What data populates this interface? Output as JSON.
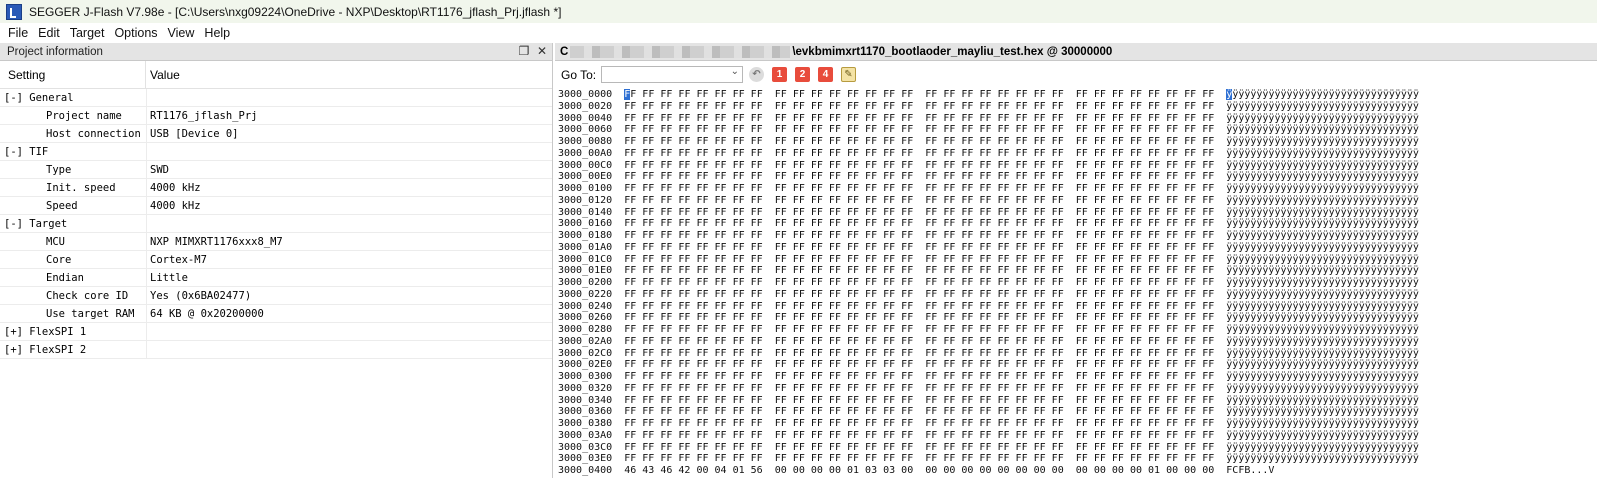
{
  "window": {
    "title": "SEGGER J-Flash V7.98e - [C:\\Users\\nxg09224\\OneDrive - NXP\\Desktop\\RT1176_jflash_Prj.jflash *]"
  },
  "menu": [
    "File",
    "Edit",
    "Target",
    "Options",
    "View",
    "Help"
  ],
  "project_panel": {
    "title": "Project information",
    "col_setting": "Setting",
    "col_value": "Value",
    "rows": [
      {
        "kind": "group",
        "key": "[-] General",
        "value": ""
      },
      {
        "kind": "sub",
        "key": "Project name",
        "value": "RT1176_jflash_Prj"
      },
      {
        "kind": "sub",
        "key": "Host connection",
        "value": "USB [Device 0]"
      },
      {
        "kind": "group",
        "key": "[-] TIF",
        "value": ""
      },
      {
        "kind": "sub",
        "key": "Type",
        "value": "SWD"
      },
      {
        "kind": "sub",
        "key": "Init. speed",
        "value": "4000 kHz"
      },
      {
        "kind": "sub",
        "key": "Speed",
        "value": "4000 kHz"
      },
      {
        "kind": "group",
        "key": "[-] Target",
        "value": ""
      },
      {
        "kind": "sub",
        "key": "MCU",
        "value": "NXP MIMXRT1176xxx8_M7"
      },
      {
        "kind": "sub",
        "key": "Core",
        "value": "Cortex-M7"
      },
      {
        "kind": "sub",
        "key": "Endian",
        "value": "Little"
      },
      {
        "kind": "sub",
        "key": "Check core ID",
        "value": "Yes (0x6BA02477)"
      },
      {
        "kind": "sub",
        "key": "Use target RAM",
        "value": "64 KB @ 0x20200000"
      },
      {
        "kind": "group",
        "key": "[+] FlexSPI 1",
        "value": ""
      },
      {
        "kind": "group",
        "key": "[+] FlexSPI 2",
        "value": ""
      }
    ]
  },
  "hex_panel": {
    "header_prefix": "C",
    "header_file": "\\evkbmimxrt1170_bootlaoder_mayliu_test.hex @ 30000000",
    "goto_label": "Go To:",
    "goto_value": "",
    "buttons": [
      "1",
      "2",
      "4"
    ],
    "fill_byte": "FF",
    "fill_ascii": "ÿ",
    "ascii_width": 32,
    "ff_addresses": [
      "3000_0000",
      "3000_0020",
      "3000_0040",
      "3000_0060",
      "3000_0080",
      "3000_00A0",
      "3000_00C0",
      "3000_00E0",
      "3000_0100",
      "3000_0120",
      "3000_0140",
      "3000_0160",
      "3000_0180",
      "3000_01A0",
      "3000_01C0",
      "3000_01E0",
      "3000_0200",
      "3000_0220",
      "3000_0240",
      "3000_0260",
      "3000_0280",
      "3000_02A0",
      "3000_02C0",
      "3000_02E0",
      "3000_0300",
      "3000_0320",
      "3000_0340",
      "3000_0360",
      "3000_0380",
      "3000_03A0",
      "3000_03C0",
      "3000_03E0"
    ],
    "last_line": {
      "addr": "3000_0400",
      "bytes": [
        "46",
        "43",
        "46",
        "42",
        "00",
        "04",
        "01",
        "56",
        "00",
        "00",
        "00",
        "00",
        "01",
        "03",
        "03",
        "00",
        "00",
        "00",
        "00",
        "00",
        "00",
        "00",
        "00",
        "00",
        "00",
        "00",
        "00",
        "00",
        "01",
        "00",
        "00",
        "00"
      ],
      "ascii": "FCFB...V"
    }
  }
}
